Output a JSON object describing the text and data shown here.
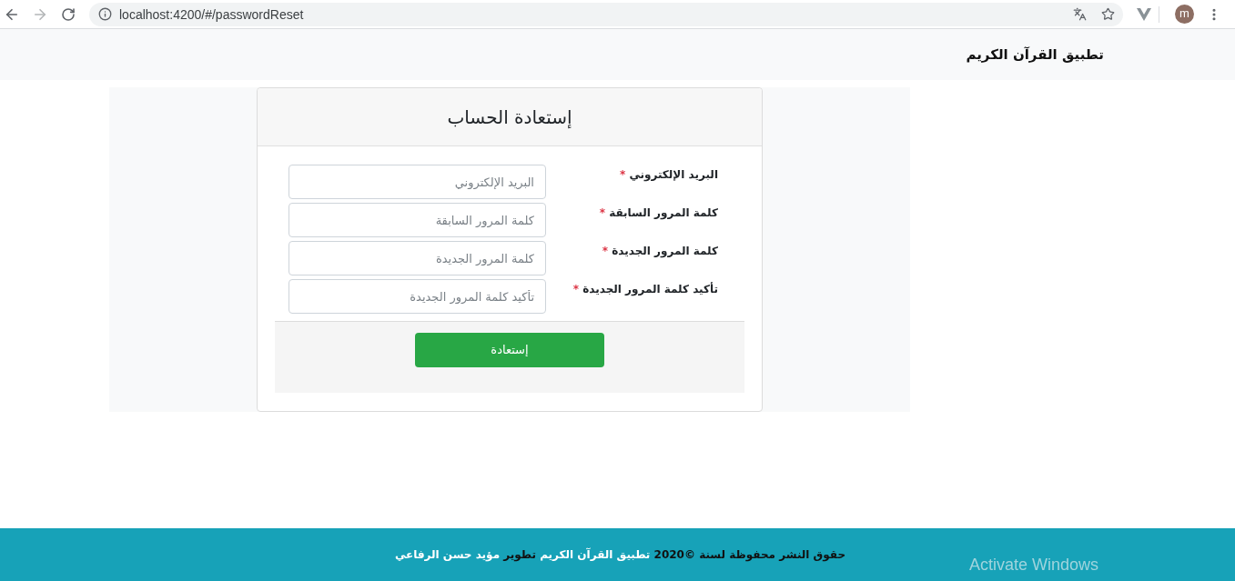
{
  "browser": {
    "nav_buttons": [
      {
        "kind": "back",
        "disabled": false
      },
      {
        "kind": "forward",
        "disabled": true
      },
      {
        "kind": "reload",
        "disabled": false
      }
    ],
    "url": "localhost:4200/#/passwordReset",
    "profile_initial": "m"
  },
  "navbar": {
    "brand": "تطبيق القرآن الكريم"
  },
  "card": {
    "title": "إستعادة الحساب",
    "fields": [
      {
        "label": "البريد الإلكتروني",
        "required_mark": "*",
        "placeholder": "البريد الإلكتروني"
      },
      {
        "label": "كلمة المرور السابقة",
        "required_mark": "*",
        "placeholder": "كلمة المرور السابقة"
      },
      {
        "label": "كلمة المرور الجديدة",
        "required_mark": "*",
        "placeholder": "كلمة المرور الجديدة"
      },
      {
        "label": "تأكيد كلمة المرور الجديدة",
        "required_mark": "*",
        "placeholder": "تأكيد كلمة المرور الجديدة"
      }
    ],
    "submit": "إستعادة"
  },
  "footer": {
    "parts": [
      {
        "kind": "plain",
        "text": "حقوق النشر محفوظة لسنة ©2020"
      },
      {
        "kind": "link",
        "text": "تطبيق القرآن الكريم"
      },
      {
        "kind": "plain",
        "text": "تطوير"
      },
      {
        "kind": "link",
        "text": "مؤيد حسن الرفاعي"
      }
    ]
  },
  "os_overlay": {
    "text": "Activate Windows"
  }
}
